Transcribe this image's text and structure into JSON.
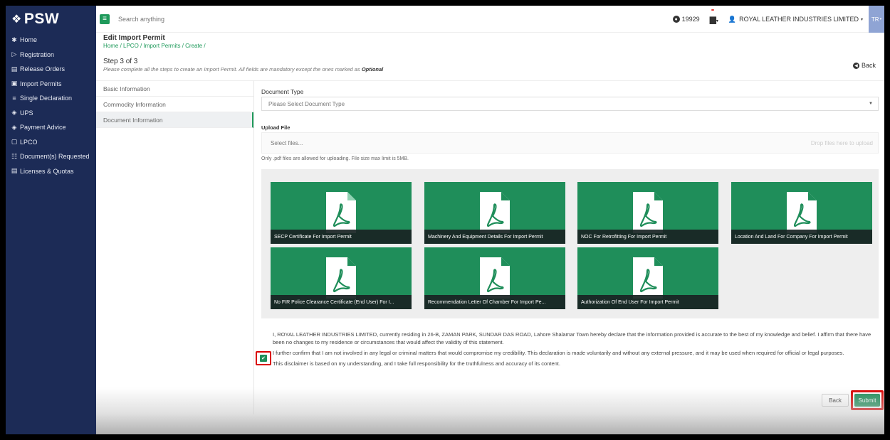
{
  "brand": {
    "name": "PSW"
  },
  "sidebar": {
    "items": [
      {
        "label": "Home",
        "icon": "✱"
      },
      {
        "label": "Registration",
        "icon": "▷"
      },
      {
        "label": "Release Orders",
        "icon": "▤"
      },
      {
        "label": "Import Permits",
        "icon": "▣"
      },
      {
        "label": "Single Declaration",
        "icon": "≡"
      },
      {
        "label": "UPS",
        "icon": "◈"
      },
      {
        "label": "Payment Advice",
        "icon": "◈"
      },
      {
        "label": "LPCO",
        "icon": "▢"
      },
      {
        "label": "Document(s) Requested",
        "icon": "☷"
      },
      {
        "label": "Licenses & Quotas",
        "icon": "▤"
      }
    ]
  },
  "topbar": {
    "search_placeholder": "Search anything",
    "coins": "19929",
    "company": "ROYAL LEATHER INDUSTRIES LIMITED",
    "user_initials": "TR"
  },
  "page": {
    "title": "Edit Import Permit",
    "breadcrumb": "Home / LPCO / Import Permits / Create /",
    "step_title": "Step 3 of 3",
    "step_desc": "Please complete all the steps to create an Import Permit. All fields are mandatory except the ones marked as",
    "step_desc_bold": "Optional",
    "back_label": "Back"
  },
  "steps": [
    {
      "label": "Basic Information"
    },
    {
      "label": "Commodity Information"
    },
    {
      "label": "Document Information"
    }
  ],
  "form": {
    "document_type_label": "Document Type",
    "document_type_placeholder": "Please Select Document Type",
    "upload_label": "Upload File",
    "upload_button": "Select files...",
    "drop_text": "Drop files here to upload",
    "upload_note": "Only .pdf files are allowed for uploading. File size max limit is 5MB."
  },
  "documents": [
    {
      "label": "SECP Certificate For Import Permit"
    },
    {
      "label": "Machinery And Equipment Details For Import Permit"
    },
    {
      "label": "NOC For Retrofitting For Import Permit"
    },
    {
      "label": "Location And Land For Company For Import Permit"
    },
    {
      "label": "No FIR Police Clearance Certificate (End User) For I..."
    },
    {
      "label": "Recommendation Letter Of Chamber For Import Pe..."
    },
    {
      "label": "Authorization Of End User For Import Permit"
    }
  ],
  "declaration": {
    "p1": "I, ROYAL LEATHER INDUSTRIES LIMITED, currently residing in 26-B, ZAMAN PARK, SUNDAR DAS ROAD, Lahore Shalamar Town hereby declare that the information provided is accurate to the best of my knowledge and belief. I affirm that there have been no changes to my residence or circumstances that would affect the validity of this statement.",
    "p2": "I further confirm that I am not involved in any legal or criminal matters that would compromise my credibility. This declaration is made voluntarily and without any external pressure, and it may be used when required for official or legal purposes.",
    "p3": "This disclaimer is based on my understanding, and I take full responsibility for the truthfulness and accuracy of its content.",
    "checked": "✔"
  },
  "actions": {
    "back": "Back",
    "submit": "Submit"
  },
  "colors": {
    "sidebar": "#1c2b56",
    "accent": "#1f8e5a",
    "highlight": "#d90000"
  }
}
